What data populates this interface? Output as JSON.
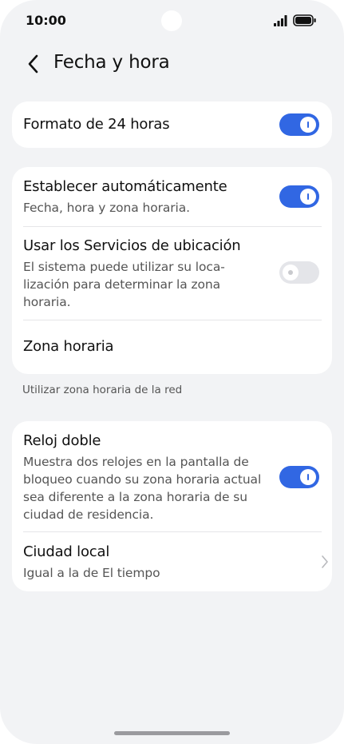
{
  "status_bar": {
    "time": "10:00"
  },
  "header": {
    "title": "Fecha y hora"
  },
  "card_format": {
    "format_24h": {
      "title": "Formato de 24 horas",
      "enabled": true
    }
  },
  "card_auto": {
    "auto_set": {
      "title": "Establecer automáticamente",
      "subtitle": "Fecha, hora y zona horaria.",
      "enabled": true
    },
    "location_services": {
      "title": "Usar los Servicios de ubicación",
      "subtitle_line1": "El sistema puede utilizar su loca-",
      "subtitle_line2": "lización para determinar la zona",
      "subtitle_line3": "horaria.",
      "enabled": false
    },
    "time_zone": {
      "title": "Zona horaria"
    }
  },
  "note": {
    "text": "Utilizar zona horaria de la red"
  },
  "card_clock": {
    "dual_clock": {
      "title": "Reloj doble",
      "subtitle_line1": "Muestra dos relojes en la pantalla de",
      "subtitle_line2": "bloqueo cuando su zona horaria actual",
      "subtitle_line3": "sea diferente a la zona horaria de su",
      "subtitle_line4": "ciudad de residencia.",
      "enabled": true
    },
    "home_city": {
      "title": "Ciudad local",
      "subtitle": "Igual a la de El tiempo"
    }
  },
  "colors": {
    "accent": "#3167e3",
    "background": "#f2f3f5",
    "card": "#ffffff"
  },
  "icons": [
    "back-arrow-icon",
    "signal-icon",
    "battery-icon",
    "chevron-right-icon"
  ]
}
